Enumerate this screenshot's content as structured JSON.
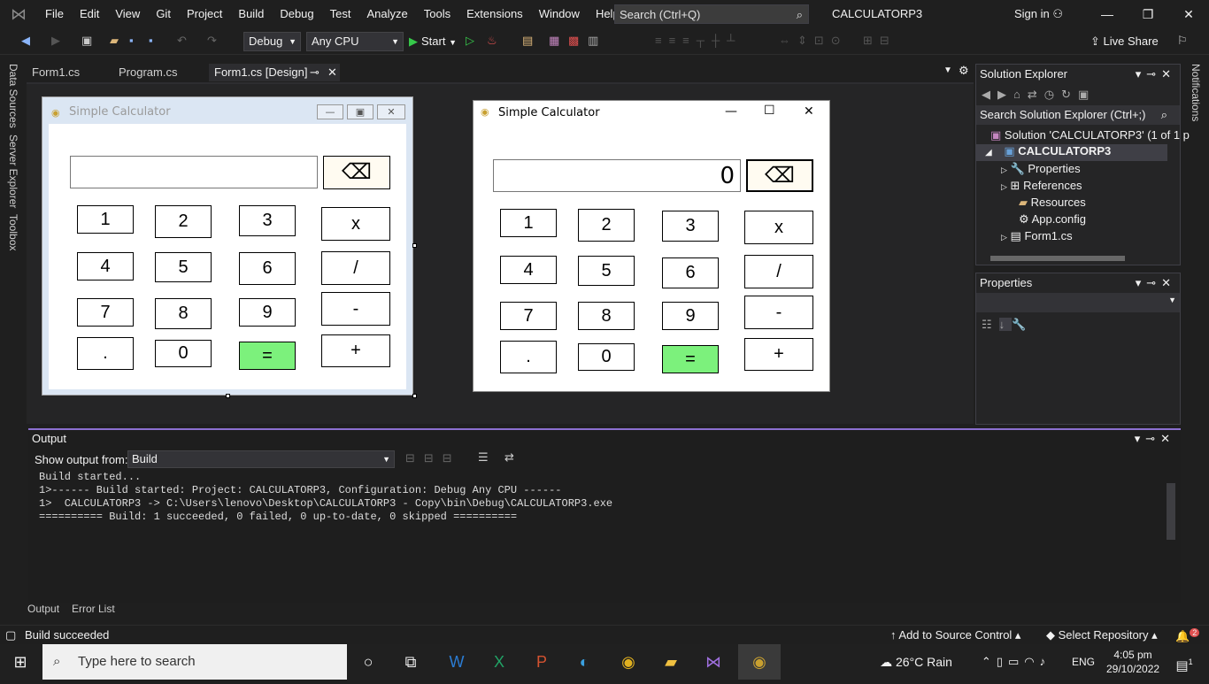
{
  "menu": [
    "File",
    "Edit",
    "View",
    "Git",
    "Project",
    "Build",
    "Debug",
    "Test",
    "Analyze",
    "Tools",
    "Extensions",
    "Window",
    "Help"
  ],
  "search": {
    "placeholder": "Search (Ctrl+Q)"
  },
  "solution_title": "CALCULATORP3",
  "sign_in": "Sign in",
  "toolbar": {
    "config": "Debug",
    "platform": "Any CPU",
    "start": "Start",
    "live_share": "Live Share"
  },
  "side_tabs": [
    "Data Sources",
    "Server Explorer",
    "Toolbox"
  ],
  "right_tab": "Notifications",
  "doc_tabs": [
    {
      "label": "Form1.cs"
    },
    {
      "label": "Program.cs"
    },
    {
      "label": "Form1.cs [Design]"
    }
  ],
  "design_form": {
    "title": "Simple Calculator",
    "display": ""
  },
  "running_form": {
    "title": "Simple Calculator",
    "display": "0"
  },
  "calc_buttons": {
    "b1": "1",
    "b2": "2",
    "b3": "3",
    "mul": "x",
    "b4": "4",
    "b5": "5",
    "b6": "6",
    "div": "/",
    "b7": "7",
    "b8": "8",
    "b9": "9",
    "sub": "-",
    "dot": ".",
    "b0": "0",
    "eq": "=",
    "add": "+"
  },
  "solution_explorer": {
    "title": "Solution Explorer",
    "search": "Search Solution Explorer (Ctrl+;)",
    "items": [
      "Solution 'CALCULATORP3' (1 of 1 p",
      "CALCULATORP3",
      "Properties",
      "References",
      "Resources",
      "App.config",
      "Form1.cs"
    ]
  },
  "properties": {
    "title": "Properties"
  },
  "output": {
    "title": "Output",
    "show_from_label": "Show output from:",
    "source": "Build",
    "lines": [
      "Build started...",
      "1>------ Build started: Project: CALCULATORP3, Configuration: Debug Any CPU ------",
      "1>  CALCULATORP3 -> C:\\Users\\lenovo\\Desktop\\CALCULATORP3 - Copy\\bin\\Debug\\CALCULATORP3.exe",
      "========== Build: 1 succeeded, 0 failed, 0 up-to-date, 0 skipped =========="
    ],
    "tabs": [
      "Output",
      "Error List"
    ]
  },
  "status": {
    "text": "Build succeeded",
    "source_control": "Add to Source Control",
    "repository": "Select Repository",
    "notif_count": "2"
  },
  "taskbar": {
    "search": "Type here to search",
    "weather": "26°C  Rain",
    "lang": "ENG",
    "time": "4:05 pm",
    "date": "29/10/2022",
    "notif": "1"
  }
}
